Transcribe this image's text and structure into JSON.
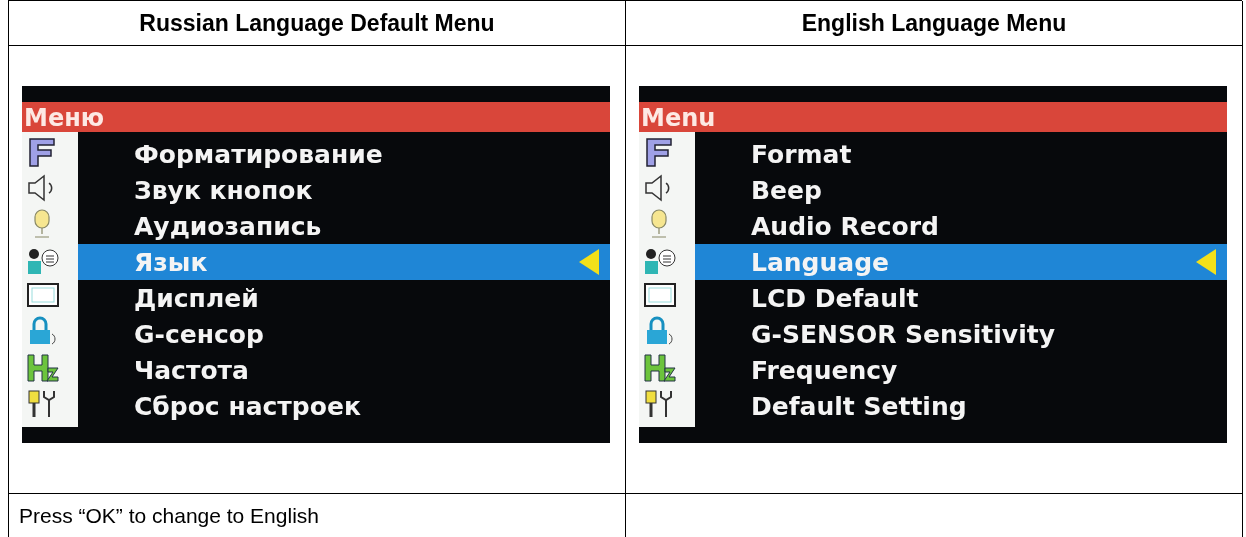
{
  "table": {
    "columns": [
      {
        "title": "Russian Language Default Menu",
        "screen": {
          "title": "Меню",
          "items": [
            {
              "label": "Форматирование",
              "selected": false
            },
            {
              "label": "Звук кнопок",
              "selected": false
            },
            {
              "label": "Аудиозапись",
              "selected": false
            },
            {
              "label": "Язык",
              "selected": true
            },
            {
              "label": "Дисплей",
              "selected": false
            },
            {
              "label": "G-сенсор",
              "selected": false
            },
            {
              "label": "Частота",
              "selected": false
            },
            {
              "label": "Сброс настроек",
              "selected": false
            }
          ]
        },
        "note": "Press “OK” to change to English"
      },
      {
        "title": "English Language Menu",
        "screen": {
          "title": "Menu",
          "items": [
            {
              "label": "Format",
              "selected": false
            },
            {
              "label": "Beep",
              "selected": false
            },
            {
              "label": "Audio Record",
              "selected": false
            },
            {
              "label": "Language",
              "selected": true
            },
            {
              "label": "LCD Default",
              "selected": false
            },
            {
              "label": "G-SENSOR Sensitivity",
              "selected": false
            },
            {
              "label": "Frequency",
              "selected": false
            },
            {
              "label": "Default Setting",
              "selected": false
            }
          ]
        }
      }
    ]
  }
}
